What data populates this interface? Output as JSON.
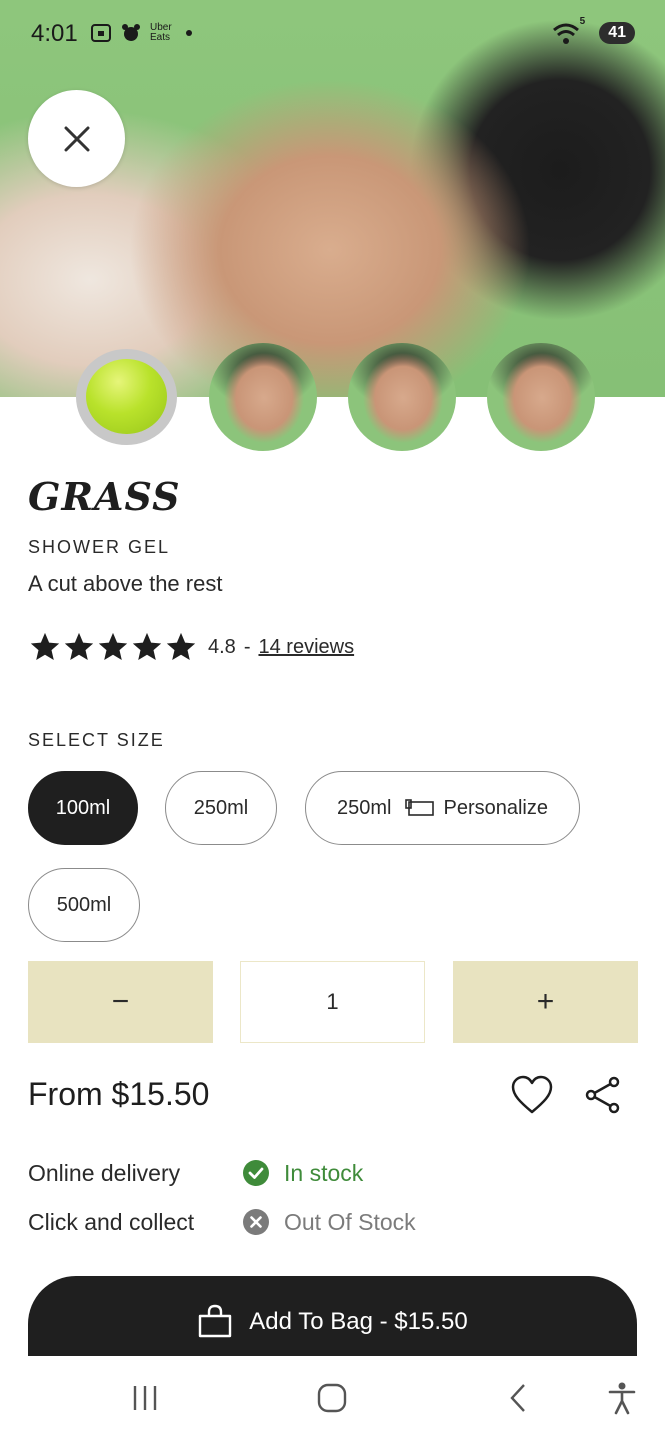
{
  "status_bar": {
    "time": "4:01",
    "notification_labels": [
      "Uber",
      "Eats"
    ],
    "battery": "41",
    "signal_badge": "5"
  },
  "product": {
    "name": "GRASS",
    "category": "SHOWER GEL",
    "tagline": "A cut above the rest",
    "rating": {
      "stars": 5,
      "value": "4.8",
      "separator": "-",
      "reviews_label": "14 reviews"
    }
  },
  "sizes": {
    "label": "SELECT SIZE",
    "options": [
      {
        "label": "100ml",
        "selected": true
      },
      {
        "label": "250ml",
        "selected": false
      },
      {
        "label": "250ml",
        "extra": "Personalize",
        "selected": false
      },
      {
        "label": "500ml",
        "selected": false
      }
    ]
  },
  "quantity": {
    "minus": "−",
    "value": "1",
    "plus": "+"
  },
  "price": "From $15.50",
  "availability": [
    {
      "label": "Online delivery",
      "status": "In stock",
      "available": true
    },
    {
      "label": "Click and collect",
      "status": "Out Of Stock",
      "available": false
    }
  ],
  "add_to_bag": "Add To Bag - $15.50",
  "colors": {
    "hero_green": "#8ec67c",
    "selected_pill": "#1f1f1f",
    "qty_button": "#e8e3c0",
    "in_stock": "#3f8b3a",
    "out_of_stock": "#7b7b7b"
  },
  "icons": [
    "close-icon",
    "star-icon",
    "personalize-icon",
    "heart-icon",
    "share-icon",
    "check-circle-icon",
    "x-circle-icon",
    "shopping-bag-icon",
    "recents-icon",
    "home-icon",
    "back-icon",
    "accessibility-icon"
  ]
}
